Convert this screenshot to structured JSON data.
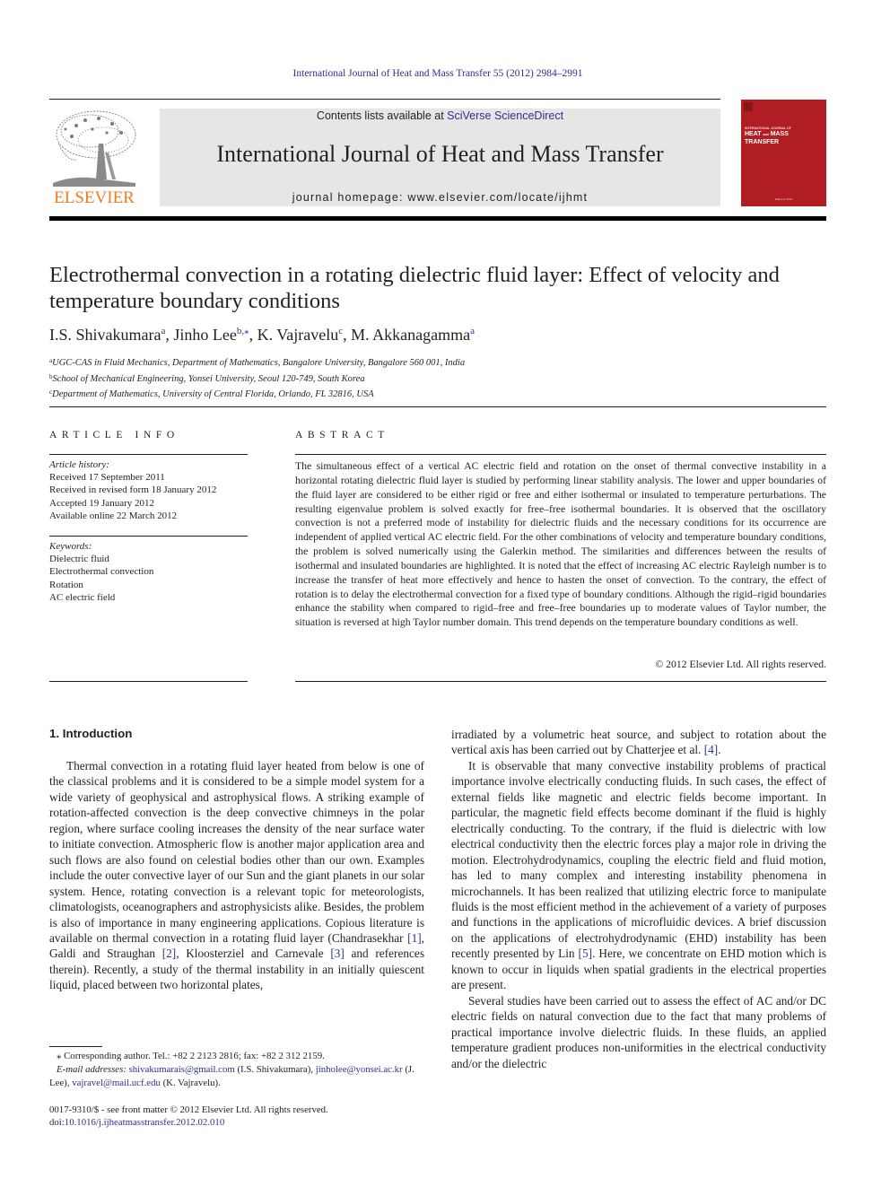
{
  "header": {
    "citation": "International Journal of Heat and Mass Transfer 55 (2012) 2984–2991",
    "contents_prefix": "Contents lists available at ",
    "contents_link": "SciVerse ScienceDirect",
    "journal_title": "International Journal of Heat and Mass Transfer",
    "homepage": "journal homepage: www.elsevier.com/locate/ijhmt",
    "publisher_logo_text": "ELSEVIER",
    "cover": {
      "small_text": "INTERNATIONAL JOURNAL OF",
      "title_line1": "HEAT",
      "title_and": "and",
      "title_line1b": "MASS",
      "title_line2": "TRANSFER",
      "bottom_text": "Editor-in-Chief",
      "color": "#b01e23"
    }
  },
  "article": {
    "title": "Electrothermal convection in a rotating dielectric fluid layer: Effect of velocity and temperature boundary conditions",
    "authors": [
      {
        "name": "I.S. Shivakumara",
        "sup": "a"
      },
      {
        "name": "Jinho Lee",
        "sup": "b,⁎"
      },
      {
        "name": "K. Vajravelu",
        "sup": "c"
      },
      {
        "name": "M. Akkanagamma",
        "sup": "a"
      }
    ],
    "affiliations": [
      {
        "sup": "a",
        "text": "UGC-CAS in Fluid Mechanics, Department of Mathematics, Bangalore University, Bangalore 560 001, India"
      },
      {
        "sup": "b",
        "text": "School of Mechanical Engineering, Yonsei University, Seoul 120-749, South Korea"
      },
      {
        "sup": "c",
        "text": "Department of Mathematics, University of Central Florida, Orlando, FL 32816, USA"
      }
    ]
  },
  "article_info": {
    "label": "ARTICLE INFO",
    "history_label": "Article history:",
    "history": [
      "Received 17 September 2011",
      "Received in revised form 18 January 2012",
      "Accepted 19 January 2012",
      "Available online 22 March 2012"
    ],
    "keywords_label": "Keywords:",
    "keywords": [
      "Dielectric fluid",
      "Electrothermal convection",
      "Rotation",
      "AC electric field"
    ]
  },
  "abstract": {
    "label": "ABSTRACT",
    "text": "The simultaneous effect of a vertical AC electric field and rotation on the onset of thermal convective instability in a horizontal rotating dielectric fluid layer is studied by performing linear stability analysis. The lower and upper boundaries of the fluid layer are considered to be either rigid or free and either isothermal or insulated to temperature perturbations. The resulting eigenvalue problem is solved exactly for free–free isothermal boundaries. It is observed that the oscillatory convection is not a preferred mode of instability for dielectric fluids and the necessary conditions for its occurrence are independent of applied vertical AC electric field. For the other combinations of velocity and temperature boundary conditions, the problem is solved numerically using the Galerkin method. The similarities and differences between the results of isothermal and insulated boundaries are highlighted. It is noted that the effect of increasing AC electric Rayleigh number is to increase the transfer of heat more effectively and hence to hasten the onset of convection. To the contrary, the effect of rotation is to delay the electrothermal convection for a fixed type of boundary conditions. Although the rigid–rigid boundaries enhance the stability when compared to rigid–free and free–free boundaries up to moderate values of Taylor number, the situation is reversed at high Taylor number domain. This trend depends on the temperature boundary conditions as well.",
    "copyright": "© 2012 Elsevier Ltd. All rights reserved."
  },
  "body": {
    "section_heading": "1. Introduction",
    "left_para1": {
      "t1": "Thermal convection in a rotating fluid layer heated from below is one of the classical problems and it is considered to be a simple model system for a wide variety of geophysical and astrophysical flows. A striking example of rotation-affected convection is the deep convective chimneys in the polar region, where surface cooling increases the density of the near surface water to initiate convection. Atmospheric flow is another major application area and such flows are also found on celestial bodies other than our own. Examples include the outer convective layer of our Sun and the giant planets in our solar system. Hence, rotating convection is a relevant topic for meteorologists, climatologists, oceanographers and astrophysicists alike. Besides, the problem is also of importance in many engineering applications. Copious literature is available on thermal convection in a rotating fluid layer (Chandrasekhar ",
      "ref1": "[1]",
      "t2": ", Galdi and Straughan ",
      "ref2": "[2]",
      "t3": ", Kloosterziel and Carnevale ",
      "ref3": "[3]",
      "t4": " and references therein). Recently, a study of the thermal instability in an initially quiescent liquid, placed between two horizontal plates,"
    },
    "right_para1": {
      "t1": "irradiated by a volumetric heat source, and subject to rotation about the vertical axis has been carried out by Chatterjee et al. ",
      "ref4": "[4]",
      "t2": "."
    },
    "right_para2": {
      "t1": "It is observable that many convective instability problems of practical importance involve electrically conducting fluids. In such cases, the effect of external fields like magnetic and electric fields become important. In particular, the magnetic field effects become dominant if the fluid is highly electrically conducting. To the contrary, if the fluid is dielectric with low electrical conductivity then the electric forces play a major role in driving the motion. Electrohydrodynamics, coupling the electric field and fluid motion, has led to many complex and interesting instability phenomena in microchannels. It has been realized that utilizing electric force to manipulate fluids is the most efficient method in the achievement of a variety of purposes and functions in the applications of microfluidic devices. A brief discussion on the applications of electrohydrodynamic (EHD) instability has been recently presented by Lin ",
      "ref5": "[5]",
      "t2": ". Here, we concentrate on EHD motion which is known to occur in liquids when spatial gradients in the electrical properties are present."
    },
    "right_para3": "Several studies have been carried out to assess the effect of AC and/or DC electric fields on natural convection due to the fact that many problems of practical importance involve dielectric fluids. In these fluids, an applied temperature gradient produces non-uniformities in the electrical conductivity and/or the dielectric"
  },
  "footnotes": {
    "corresponding": "⁎ Corresponding author. Tel.: +82 2 2123 2816; fax: +82 2 312 2159.",
    "email_label": "E-mail addresses: ",
    "email1": "shivakumarais@gmail.com",
    "email1_owner": " (I.S. Shivakumara), ",
    "email2": "jinholee@yonsei.ac.kr",
    "email2_owner": " (J. Lee), ",
    "email3": "vajravel@mail.ucf.edu",
    "email3_owner": " (K. Vajravelu).",
    "front_matter": "0017-9310/$ - see front matter © 2012 Elsevier Ltd. All rights reserved.",
    "doi_prefix": "doi:",
    "doi": "10.1016/j.ijheatmasstransfer.2012.02.010"
  },
  "colors": {
    "link": "#2e3192",
    "elsevier_orange": "#f47b20",
    "banner_gray": "#e6e6e6"
  }
}
